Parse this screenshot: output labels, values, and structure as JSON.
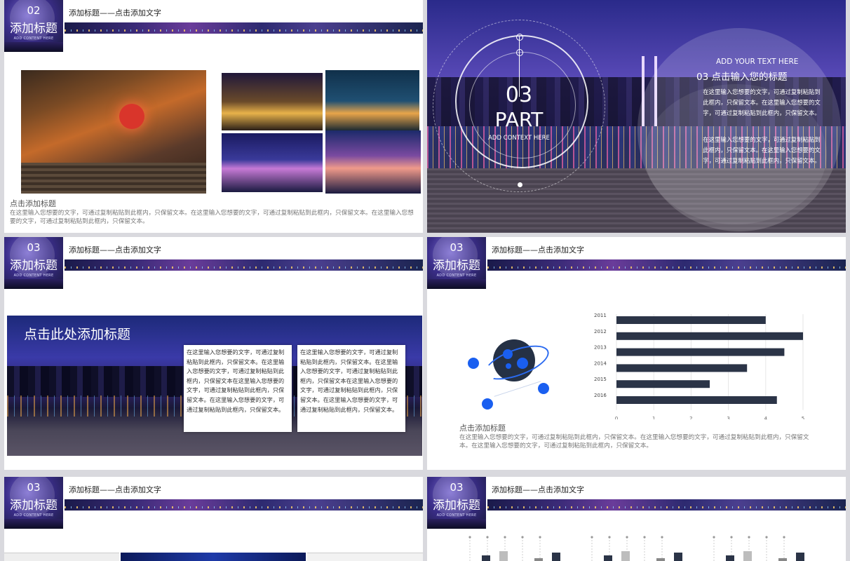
{
  "header": {
    "title": "添加标题——点击添加文字",
    "badge_title": "添加标题",
    "badge_sub": "ADD CONTENT HERE"
  },
  "slide1": {
    "badge_num": "02",
    "caption": "点击添加标题",
    "body": "在这里输入您想要的文字，可通过复制粘贴到此框内，只保留文本。在这里输入您想要的文字，可通过复制粘贴到此框内，只保留文本。在这里输入您想要的文字，可通过复制粘贴到此框内，只保留文本。"
  },
  "slide2": {
    "num": "03",
    "part": "PART",
    "context": "ADD CONTEXT HERE",
    "add_text": "ADD YOUR TEXT HERE",
    "heading": "03  点击输入您的标题",
    "para1": "在这里输入您想要的文字，可通过复制粘贴到此框内，只保留文本。在这里输入您想要的文字，可通过复制粘贴到此框内，只保留文本。",
    "para2": "在这里输入您想要的文字，可通过复制粘贴到此框内，只保留文本。在这里输入您想要的文字，可通过复制粘贴到此框内，只保留文本。"
  },
  "slide3": {
    "badge_num": "03",
    "heading": "点击此处添加标题",
    "box1": "在这里输入您想要的文字，可通过复制粘贴到此框内，只保留文本。在这里输入您想要的文字，可通过复制粘贴到此框内，只保留文本在这里输入您想要的文字，可通过复制粘贴到此框内，只保留文本。在这里输入您想要的文字，可通过复制粘贴到此框内，只保留文本。",
    "box2": "在这里输入您想要的文字，可通过复制粘贴到此框内，只保留文本。在这里输入您想要的文字，可通过复制粘贴到此框内，只保留文本在这里输入您想要的文字，可通过复制粘贴到此框内，只保留文本。在这里输入您想要的文字，可通过复制粘贴到此框内，只保留文本。"
  },
  "slide4": {
    "badge_num": "03",
    "caption": "点击添加标题",
    "body": "在这里输入您想要的文字，可通过复制粘贴到此框内，只保留文本。在这里输入您想要的文字，可通过复制粘贴到此框内，只保留文本。在这里输入您想要的文字，可通过复制粘贴到此框内，只保留文本。"
  },
  "slide5": {
    "badge_num": "03"
  },
  "slide6": {
    "badge_num": "03"
  },
  "colors": {
    "bar": "#2b3447",
    "accent": "#1a5ff0"
  },
  "chart_data": {
    "type": "bar",
    "orientation": "horizontal",
    "categories": [
      "2011",
      "2012",
      "2013",
      "2014",
      "2015",
      "2016"
    ],
    "values": [
      4.0,
      5.0,
      4.5,
      3.5,
      2.5,
      4.3
    ],
    "xlim": [
      0,
      5
    ],
    "xticks": [
      "0",
      "1",
      "2",
      "3",
      "4",
      "5"
    ],
    "grid": true
  }
}
